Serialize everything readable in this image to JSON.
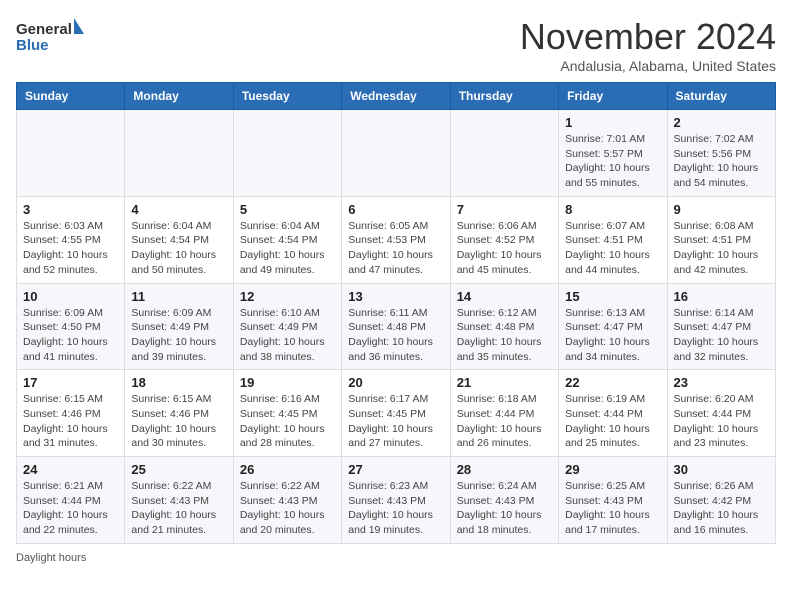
{
  "header": {
    "logo_line1": "General",
    "logo_line2": "Blue",
    "month": "November 2024",
    "location": "Andalusia, Alabama, United States"
  },
  "days_of_week": [
    "Sunday",
    "Monday",
    "Tuesday",
    "Wednesday",
    "Thursday",
    "Friday",
    "Saturday"
  ],
  "footer": {
    "daylight_label": "Daylight hours"
  },
  "weeks": [
    [
      {
        "day": "",
        "info": ""
      },
      {
        "day": "",
        "info": ""
      },
      {
        "day": "",
        "info": ""
      },
      {
        "day": "",
        "info": ""
      },
      {
        "day": "",
        "info": ""
      },
      {
        "day": "1",
        "info": "Sunrise: 7:01 AM\nSunset: 5:57 PM\nDaylight: 10 hours and 55 minutes."
      },
      {
        "day": "2",
        "info": "Sunrise: 7:02 AM\nSunset: 5:56 PM\nDaylight: 10 hours and 54 minutes."
      }
    ],
    [
      {
        "day": "3",
        "info": "Sunrise: 6:03 AM\nSunset: 4:55 PM\nDaylight: 10 hours and 52 minutes."
      },
      {
        "day": "4",
        "info": "Sunrise: 6:04 AM\nSunset: 4:54 PM\nDaylight: 10 hours and 50 minutes."
      },
      {
        "day": "5",
        "info": "Sunrise: 6:04 AM\nSunset: 4:54 PM\nDaylight: 10 hours and 49 minutes."
      },
      {
        "day": "6",
        "info": "Sunrise: 6:05 AM\nSunset: 4:53 PM\nDaylight: 10 hours and 47 minutes."
      },
      {
        "day": "7",
        "info": "Sunrise: 6:06 AM\nSunset: 4:52 PM\nDaylight: 10 hours and 45 minutes."
      },
      {
        "day": "8",
        "info": "Sunrise: 6:07 AM\nSunset: 4:51 PM\nDaylight: 10 hours and 44 minutes."
      },
      {
        "day": "9",
        "info": "Sunrise: 6:08 AM\nSunset: 4:51 PM\nDaylight: 10 hours and 42 minutes."
      }
    ],
    [
      {
        "day": "10",
        "info": "Sunrise: 6:09 AM\nSunset: 4:50 PM\nDaylight: 10 hours and 41 minutes."
      },
      {
        "day": "11",
        "info": "Sunrise: 6:09 AM\nSunset: 4:49 PM\nDaylight: 10 hours and 39 minutes."
      },
      {
        "day": "12",
        "info": "Sunrise: 6:10 AM\nSunset: 4:49 PM\nDaylight: 10 hours and 38 minutes."
      },
      {
        "day": "13",
        "info": "Sunrise: 6:11 AM\nSunset: 4:48 PM\nDaylight: 10 hours and 36 minutes."
      },
      {
        "day": "14",
        "info": "Sunrise: 6:12 AM\nSunset: 4:48 PM\nDaylight: 10 hours and 35 minutes."
      },
      {
        "day": "15",
        "info": "Sunrise: 6:13 AM\nSunset: 4:47 PM\nDaylight: 10 hours and 34 minutes."
      },
      {
        "day": "16",
        "info": "Sunrise: 6:14 AM\nSunset: 4:47 PM\nDaylight: 10 hours and 32 minutes."
      }
    ],
    [
      {
        "day": "17",
        "info": "Sunrise: 6:15 AM\nSunset: 4:46 PM\nDaylight: 10 hours and 31 minutes."
      },
      {
        "day": "18",
        "info": "Sunrise: 6:15 AM\nSunset: 4:46 PM\nDaylight: 10 hours and 30 minutes."
      },
      {
        "day": "19",
        "info": "Sunrise: 6:16 AM\nSunset: 4:45 PM\nDaylight: 10 hours and 28 minutes."
      },
      {
        "day": "20",
        "info": "Sunrise: 6:17 AM\nSunset: 4:45 PM\nDaylight: 10 hours and 27 minutes."
      },
      {
        "day": "21",
        "info": "Sunrise: 6:18 AM\nSunset: 4:44 PM\nDaylight: 10 hours and 26 minutes."
      },
      {
        "day": "22",
        "info": "Sunrise: 6:19 AM\nSunset: 4:44 PM\nDaylight: 10 hours and 25 minutes."
      },
      {
        "day": "23",
        "info": "Sunrise: 6:20 AM\nSunset: 4:44 PM\nDaylight: 10 hours and 23 minutes."
      }
    ],
    [
      {
        "day": "24",
        "info": "Sunrise: 6:21 AM\nSunset: 4:44 PM\nDaylight: 10 hours and 22 minutes."
      },
      {
        "day": "25",
        "info": "Sunrise: 6:22 AM\nSunset: 4:43 PM\nDaylight: 10 hours and 21 minutes."
      },
      {
        "day": "26",
        "info": "Sunrise: 6:22 AM\nSunset: 4:43 PM\nDaylight: 10 hours and 20 minutes."
      },
      {
        "day": "27",
        "info": "Sunrise: 6:23 AM\nSunset: 4:43 PM\nDaylight: 10 hours and 19 minutes."
      },
      {
        "day": "28",
        "info": "Sunrise: 6:24 AM\nSunset: 4:43 PM\nDaylight: 10 hours and 18 minutes."
      },
      {
        "day": "29",
        "info": "Sunrise: 6:25 AM\nSunset: 4:43 PM\nDaylight: 10 hours and 17 minutes."
      },
      {
        "day": "30",
        "info": "Sunrise: 6:26 AM\nSunset: 4:42 PM\nDaylight: 10 hours and 16 minutes."
      }
    ]
  ]
}
